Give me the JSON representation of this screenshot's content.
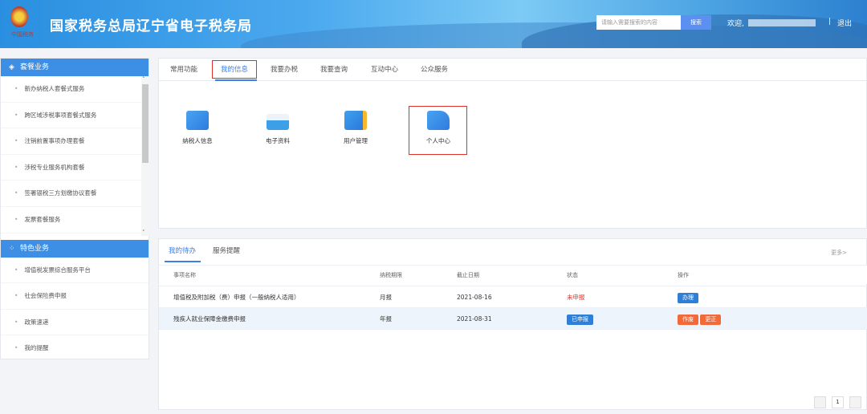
{
  "header": {
    "title": "国家税务总局辽宁省电子税务局",
    "seal_text": "中国税务",
    "search_placeholder": "请输入需要搜索的内容",
    "search_button": "搜索",
    "welcome": "欢迎,",
    "separator": "|",
    "logout": "退出"
  },
  "sidebar": {
    "sections": [
      {
        "title": "套餐业务",
        "icon": "layers-icon",
        "items": [
          "新办纳税人套餐式服务",
          "跨区域涉税事项套餐式服务",
          "注销前置事项办理套餐",
          "涉税专业服务机构套餐",
          "签署银税三方划缴协议套餐",
          "发票套餐服务"
        ]
      },
      {
        "title": "特色业务",
        "icon": "grid-icon",
        "items": [
          "增值税发票综合服务平台",
          "社会保险费申报",
          "政策速递",
          "我的提醒"
        ]
      }
    ]
  },
  "main": {
    "tabs": [
      "常用功能",
      "我的信息",
      "我要办税",
      "我要查询",
      "互动中心",
      "公众服务"
    ],
    "active_tab": "我的信息",
    "icons": [
      {
        "label": "纳税人信息",
        "icon": "taxpayer-info-icon"
      },
      {
        "label": "电子资料",
        "icon": "electronic-docs-icon"
      },
      {
        "label": "用户管理",
        "icon": "user-management-icon"
      },
      {
        "label": "个人中心",
        "icon": "personal-center-icon"
      }
    ]
  },
  "todo": {
    "tabs": [
      "我的待办",
      "服务提醒"
    ],
    "more": "更多>",
    "columns": [
      "事项名称",
      "纳税期限",
      "截止日期",
      "状态",
      "操作"
    ],
    "rows": [
      {
        "name": "增值税及附加税（费）申报（一般纳税人适用）",
        "period": "月报",
        "deadline": "2021-08-16",
        "status": "未申报",
        "actions": [
          "办理"
        ]
      },
      {
        "name": "残疾人就业保障金缴费申报",
        "period": "年报",
        "deadline": "2021-08-31",
        "status": "已申报",
        "actions": [
          "作废",
          "更正"
        ]
      }
    ],
    "page": "1"
  },
  "colors": {
    "accent": "#3d8fe6",
    "danger": "#e0302a",
    "action_blue": "#2f7fd8",
    "action_orange": "#f26a3a"
  }
}
